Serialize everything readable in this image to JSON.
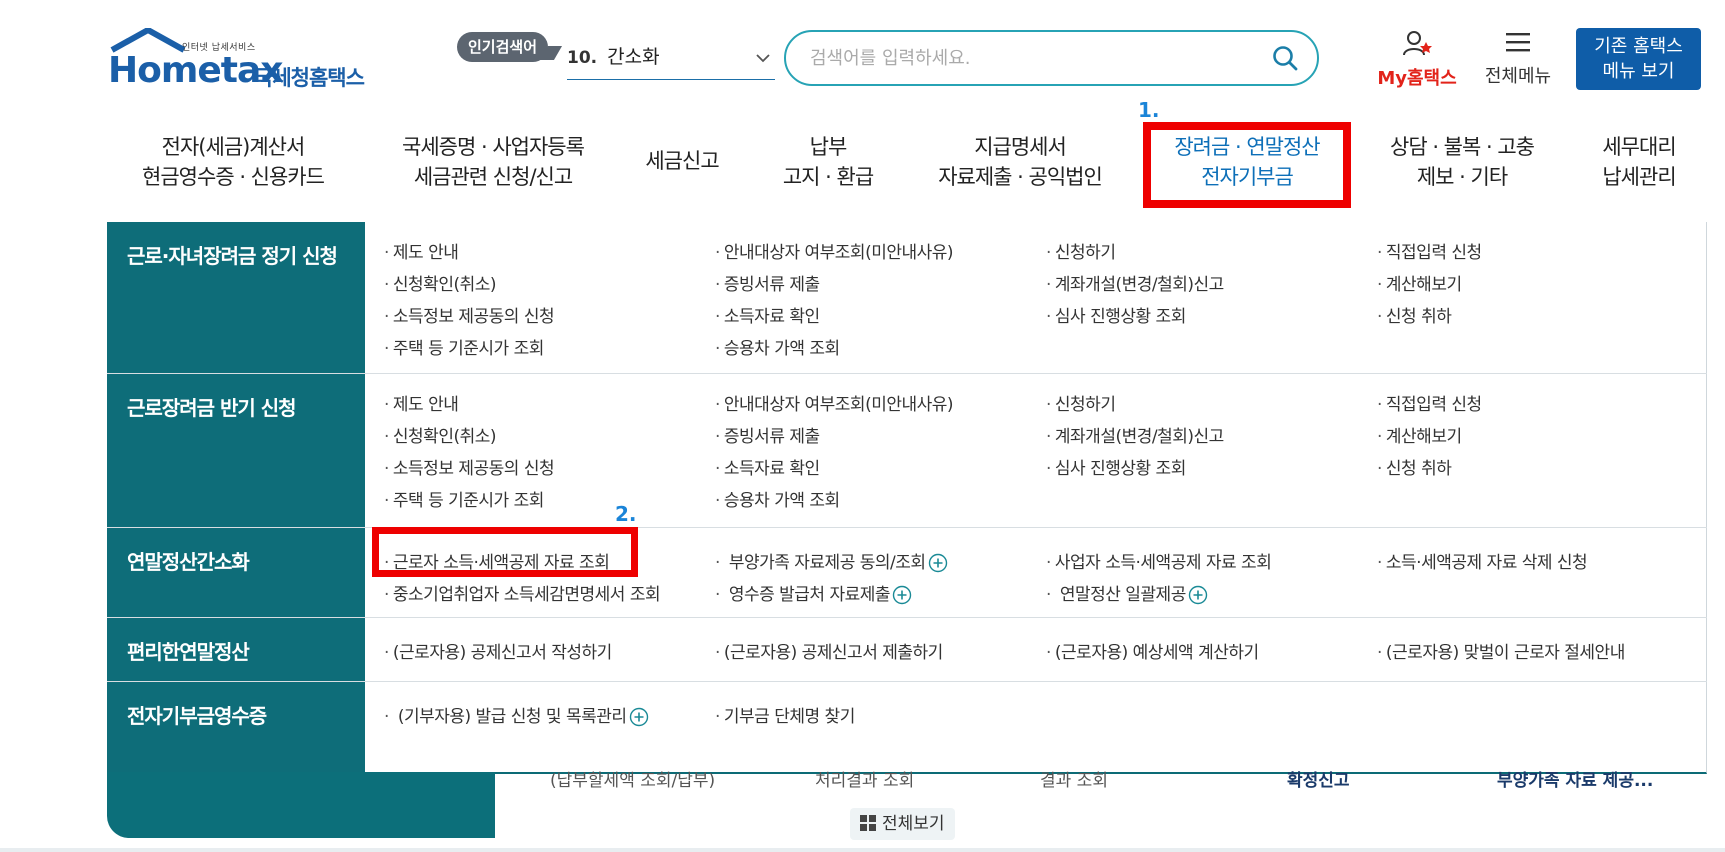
{
  "header": {
    "logo": {
      "tagline": "인터넷 납세서비스",
      "brand": "Hometax",
      "brand_kr": "국세청홈택스"
    },
    "popular": {
      "badge": "인기검색어",
      "rank": "10.",
      "keyword": "간소화"
    },
    "search": {
      "placeholder": "검색어를 입력하세요."
    },
    "my_hometax": "My홈택스",
    "full_menu": "전체메뉴",
    "old_site_line1": "기존 홈택스",
    "old_site_line2": "메뉴 보기"
  },
  "nav": {
    "items": [
      {
        "line1": "전자(세금)계산서",
        "line2": "현금영수증 · 신용카드"
      },
      {
        "line1": "국세증명 · 사업자등록",
        "line2": "세금관련 신청/신고"
      },
      {
        "line1": "세금신고",
        "line2": ""
      },
      {
        "line1": "납부",
        "line2": "고지 · 환급"
      },
      {
        "line1": "지급명세서",
        "line2": "자료제출 · 공익법인"
      },
      {
        "line1": "장려금 · 연말정산",
        "line2": "전자기부금"
      },
      {
        "line1": "상담 · 불복 · 고충",
        "line2": "제보 · 기타"
      },
      {
        "line1": "세무대리",
        "line2": "납세관리"
      }
    ]
  },
  "annotations": {
    "step1": "1.",
    "step2": "2."
  },
  "mega": {
    "rows": [
      {
        "title": "근로·자녀장려금 정기 신청",
        "cols": [
          [
            "제도 안내",
            "신청확인(취소)",
            "소득정보 제공동의 신청",
            "주택 등 기준시가 조회"
          ],
          [
            "안내대상자 여부조회(미안내사유)",
            "증빙서류 제출",
            "소득자료 확인",
            "승용차 가액 조회"
          ],
          [
            "신청하기",
            "계좌개설(변경/철회)신고",
            "심사 진행상황 조회"
          ],
          [
            "직접입력 신청",
            "계산해보기",
            "신청 취하"
          ]
        ]
      },
      {
        "title": "근로장려금 반기 신청",
        "cols": [
          [
            "제도 안내",
            "신청확인(취소)",
            "소득정보 제공동의 신청",
            "주택 등 기준시가 조회"
          ],
          [
            "안내대상자 여부조회(미안내사유)",
            "증빙서류 제출",
            "소득자료 확인",
            "승용차 가액 조회"
          ],
          [
            "신청하기",
            "계좌개설(변경/철회)신고",
            "심사 진행상황 조회"
          ],
          [
            "직접입력 신청",
            "계산해보기",
            "신청 취하"
          ]
        ]
      },
      {
        "title": "연말정산간소화",
        "cols": [
          [
            "근로자 소득·세액공제 자료 조회",
            "중소기업취업자 소득세감면명세서 조회"
          ],
          [
            "부양가족 자료제공 동의/조회",
            "영수증 발급처 자료제출"
          ],
          [
            "사업자 소득·세액공제 자료 조회",
            "연말정산 일괄제공"
          ],
          [
            "소득·세액공제 자료 삭제 신청"
          ]
        ]
      },
      {
        "title": "편리한연말정산",
        "cols": [
          [
            "(근로자용) 공제신고서 작성하기"
          ],
          [
            "(근로자용) 공제신고서 제출하기"
          ],
          [
            "(근로자용) 예상세액 계산하기"
          ],
          [
            "(근로자용) 맞벌이 근로자 절세안내"
          ]
        ]
      },
      {
        "title": "전자기부금영수증",
        "cols": [
          [
            "(기부자용) 발급 신청 및 목록관리"
          ],
          [
            "기부금 단체명 찾기"
          ]
        ]
      }
    ]
  },
  "under": {
    "items": [
      "(납부할세액 조회/납부)",
      "처리결과 조회",
      "결과 조회",
      "확정신고",
      "부양가족 자료 제공..."
    ],
    "view_all": "전체보기"
  },
  "colors": {
    "teal": "#0e6d79",
    "accent_blue": "#0d6fb8",
    "highlight_red": "#ee0000",
    "search_border": "#27a3b5"
  }
}
